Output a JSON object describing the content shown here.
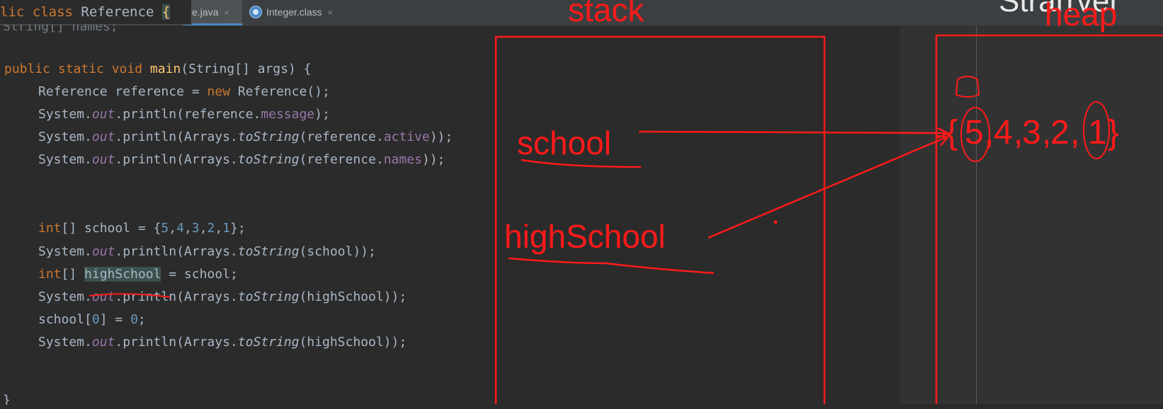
{
  "editor": {
    "sticky_header": {
      "prefix": "lic class",
      "class_name": "Reference",
      "brace": "{"
    },
    "tabs": [
      {
        "label": "ce.java",
        "close": "×"
      },
      {
        "label": "Integer.class",
        "close": "×"
      }
    ],
    "cut_line": "String[] names;",
    "closing_brace": "}",
    "lines": {
      "main_sig": {
        "a": "public static void ",
        "b": "main",
        "c": "(String[] args) {"
      },
      "l_ref": {
        "a": "Reference reference = ",
        "b": "new",
        "c": " Reference();"
      },
      "l_msg": {
        "a": "System.",
        "b": "out",
        "c": ".println(reference.",
        "d": "message",
        "e": ");"
      },
      "l_active": {
        "a": "System.",
        "b": "out",
        "c": ".println(Arrays.",
        "d": "toString",
        "e": "(reference.",
        "f": "active",
        "g": "));"
      },
      "l_names": {
        "a": "System.",
        "b": "out",
        "c": ".println(Arrays.",
        "d": "toString",
        "e": "(reference.",
        "f": "names",
        "g": "));"
      },
      "l_school": {
        "a": "int",
        "b": "[] school = {",
        "n1": "5",
        "c1": ",",
        "n2": "4",
        "c2": ",",
        "n3": "3",
        "c3": ",",
        "n4": "2",
        "c4": ",",
        "n5": "1",
        "e": "};"
      },
      "l_print_school": {
        "a": "System.",
        "b": "out",
        "c": ".println(Arrays.",
        "d": "toString",
        "e": "(school));"
      },
      "l_high": {
        "a": "int",
        "b": "[] ",
        "c": "highSchool",
        "d": " = school;"
      },
      "l_print_high": {
        "a": "System.",
        "b": "out",
        "c": ".println(Arrays.",
        "d": "toString",
        "e": "(highSchool));"
      },
      "l_assign": {
        "a": "school[",
        "n1": "0",
        "b": "] = ",
        "n2": "0",
        "c": ";"
      },
      "l_print_high2": {
        "a": "System.",
        "b": "out",
        "c": ".println(Arrays.",
        "d": "toString",
        "e": "(highSchool));"
      }
    }
  },
  "annotations": {
    "stack_label": "stack",
    "heap_label": "heap",
    "top_right_cut": "Strarrver",
    "school": "school",
    "highSchool": "highSchool",
    "array_digits": [
      "{",
      "5",
      ",",
      "4",
      ",",
      "3",
      ",",
      "2",
      ",",
      "1",
      "}"
    ],
    "ink_color": "#ff1a1a"
  }
}
